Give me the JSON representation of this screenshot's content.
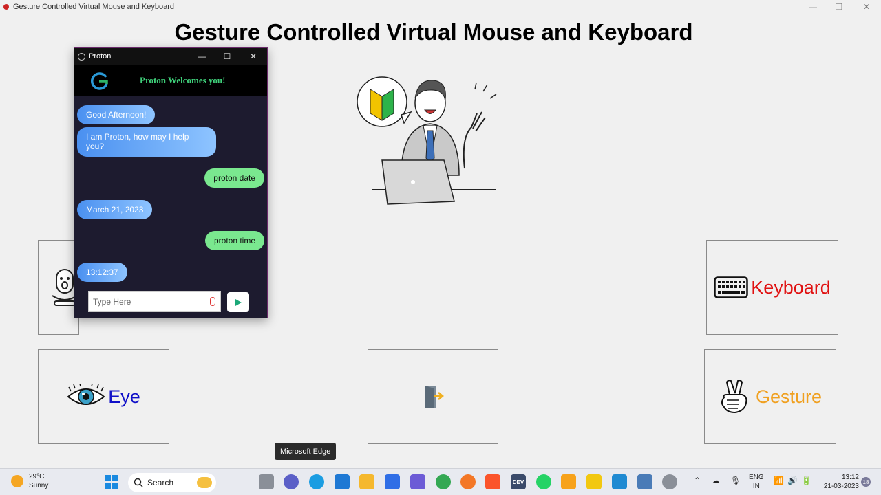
{
  "window": {
    "title": "Gesture Controlled Virtual Mouse and Keyboard",
    "minimize": "—",
    "restore": "❐",
    "close": "✕"
  },
  "page": {
    "heading": "Gesture Controlled Virtual Mouse and Keyboard"
  },
  "tiles": {
    "keyboard_label": "Keyboard",
    "eye_label": "Eye",
    "gesture_label": "Gesture"
  },
  "colors": {
    "keyboard": "#e01010",
    "eye": "#1010c8",
    "gesture": "#f0a020"
  },
  "proton": {
    "window_title": "Proton",
    "welcome": "Proton Welcomes you!",
    "messages": [
      {
        "from": "bot",
        "text": "Good Afternoon!"
      },
      {
        "from": "bot",
        "text": "I am Proton, how may I help you?"
      },
      {
        "from": "user",
        "text": "proton date"
      },
      {
        "from": "bot",
        "text": "March 21, 2023"
      },
      {
        "from": "user",
        "text": "proton time"
      },
      {
        "from": "bot",
        "text": "13:12:37"
      }
    ],
    "input_placeholder": "Type Here"
  },
  "tooltip": "Microsoft Edge",
  "taskbar": {
    "weather_temp": "29°C",
    "weather_desc": "Sunny",
    "search_label": "Search",
    "language": "ENG",
    "region": "IN",
    "time": "13:12",
    "date": "21-03-2023",
    "notification_count": "18"
  }
}
